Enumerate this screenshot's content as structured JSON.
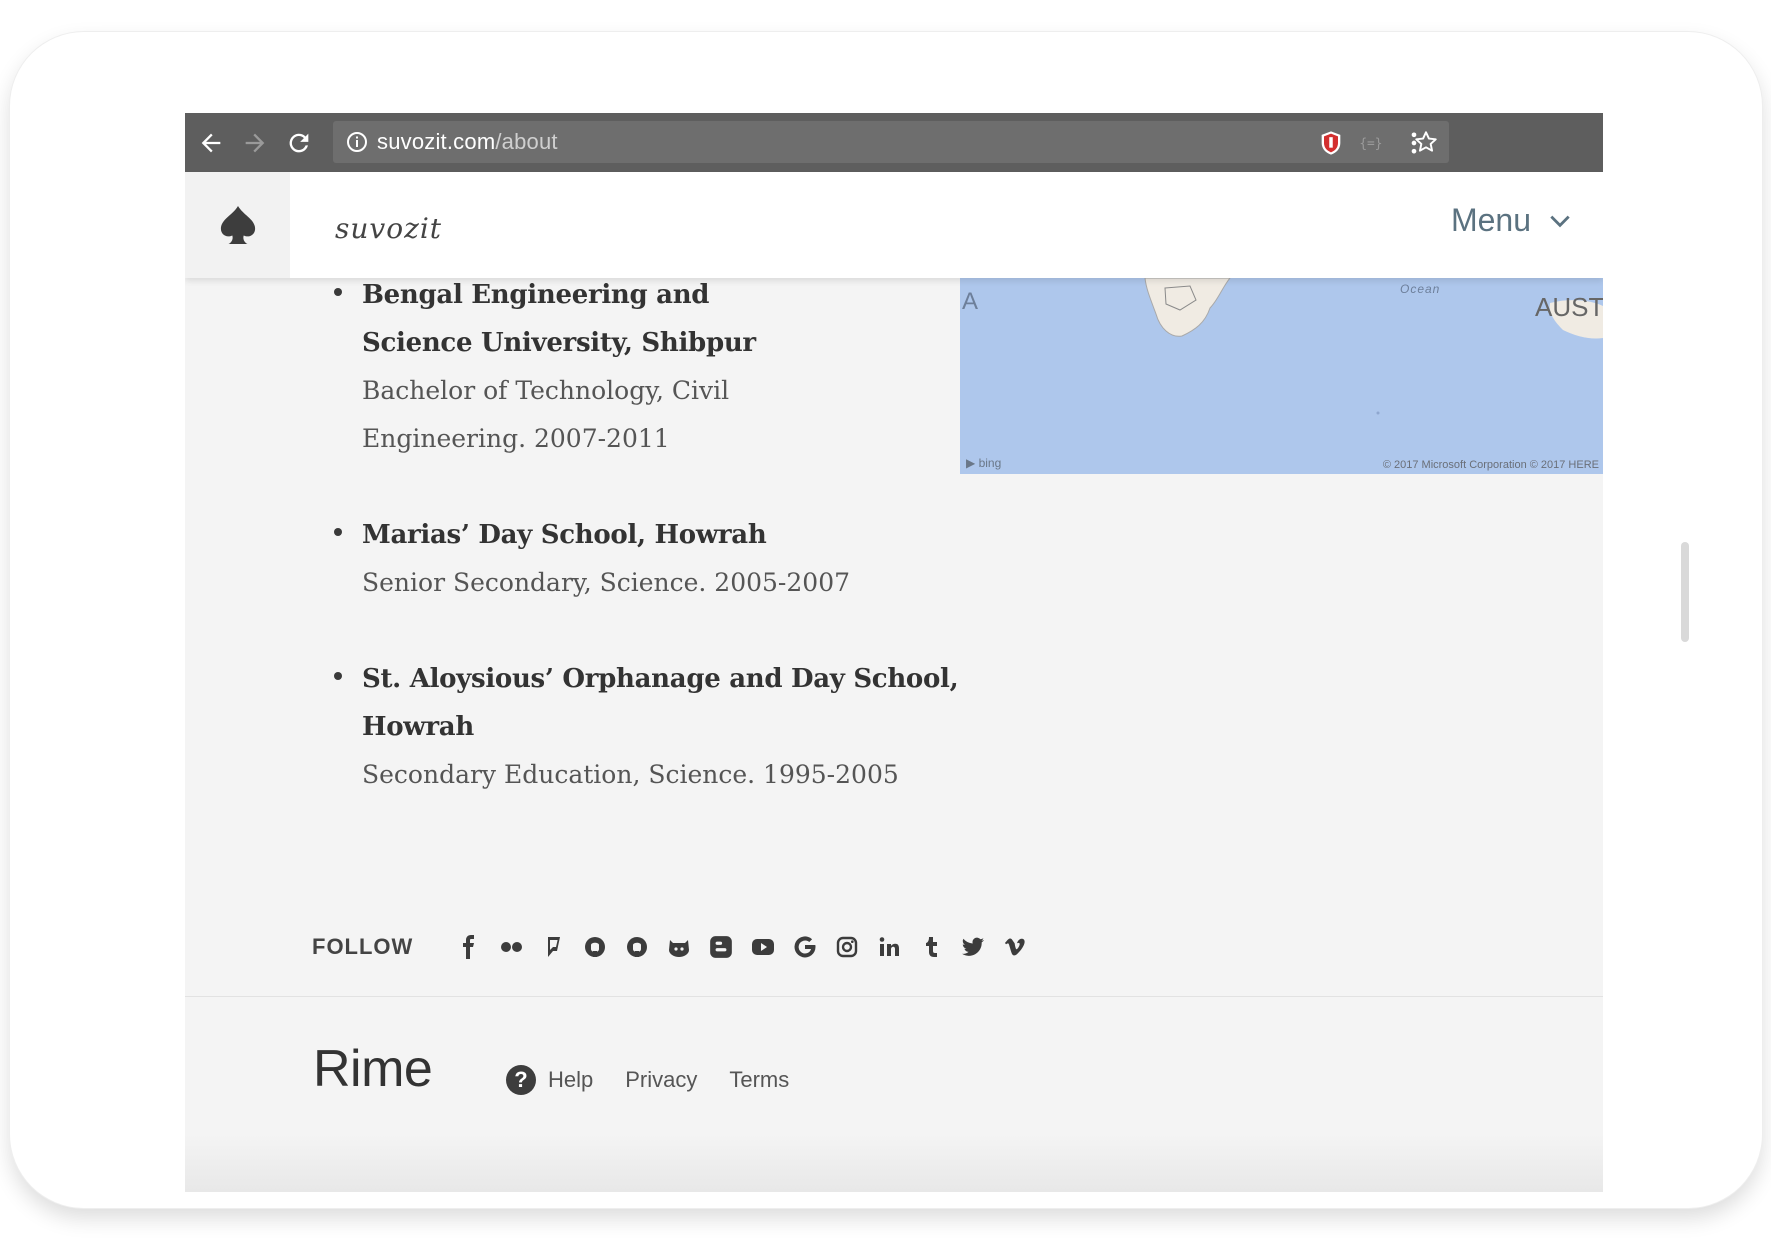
{
  "browser": {
    "url_host": "suvozit.com",
    "url_path": "/about"
  },
  "site": {
    "brand": "suvozit",
    "menu_label": "Menu"
  },
  "map": {
    "label_left": "A",
    "label_ocean": "Ocean",
    "label_aust": "AUST",
    "bing": "bing",
    "copyright": "© 2017 Microsoft Corporation © 2017 HERE"
  },
  "education": [
    {
      "school": "Bengal Engineering and Science University, Shibpur",
      "degree": "Bachelor of Technology, Civil Engineering. 2007-2011"
    },
    {
      "school": "Marias’ Day School, Howrah",
      "degree": "Senior Secondary, Science. 2005-2007"
    },
    {
      "school": "St. Aloysious’ Orphanage and Day School, Howrah",
      "degree": "Secondary Education, Science. 1995-2005"
    }
  ],
  "follow": {
    "label": "FOLLOW",
    "icons": [
      "facebook-icon",
      "flickr-icon",
      "foursquare-icon",
      "github-icon",
      "github-alt-icon",
      "gitlab-icon",
      "blogger-icon",
      "youtube-icon",
      "google-icon",
      "instagram-icon",
      "linkedin-icon",
      "tumblr-icon",
      "twitter-icon",
      "vimeo-icon"
    ]
  },
  "footer": {
    "logo": "Rime",
    "help": "Help",
    "privacy": "Privacy",
    "terms": "Terms"
  }
}
